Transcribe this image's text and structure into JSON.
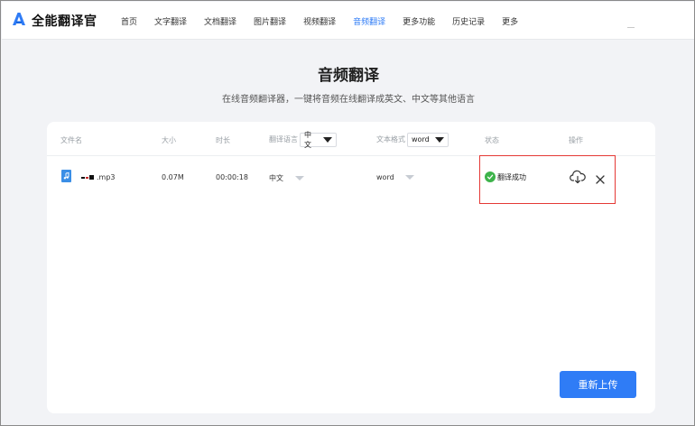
{
  "app": {
    "logo_text": "全能翻译官",
    "accent_color": "#2f7cf6"
  },
  "nav": {
    "items": [
      {
        "label": "首页"
      },
      {
        "label": "文字翻译"
      },
      {
        "label": "文档翻译"
      },
      {
        "label": "图片翻译"
      },
      {
        "label": "视频翻译"
      },
      {
        "label": "音频翻译"
      },
      {
        "label": "更多功能"
      },
      {
        "label": "历史记录"
      },
      {
        "label": "更多"
      }
    ],
    "active": "音频翻译"
  },
  "page": {
    "title": "音频翻译",
    "subtitle": "在线音频翻译器，一键将音频在线翻译成英文、中文等其他语言"
  },
  "table": {
    "headers": {
      "filename": "文件名",
      "size": "大小",
      "duration": "时长",
      "language": "翻译语言",
      "format": "文本格式",
      "status": "状态",
      "actions": "操作"
    },
    "header_language_value": "中文",
    "header_format_value": "word",
    "rows": [
      {
        "filename": ".mp3",
        "size": "0.07M",
        "duration": "00:00:18",
        "language": "中文",
        "format": "word",
        "status": "翻译成功",
        "status_color": "#3db34a"
      }
    ]
  },
  "actions": {
    "reupload_label": "重新上传"
  },
  "icons": {
    "logo": "logo-a-icon",
    "file": "music-file-icon",
    "status": "check-circle-icon",
    "download": "cloud-download-icon",
    "delete": "close-icon"
  }
}
